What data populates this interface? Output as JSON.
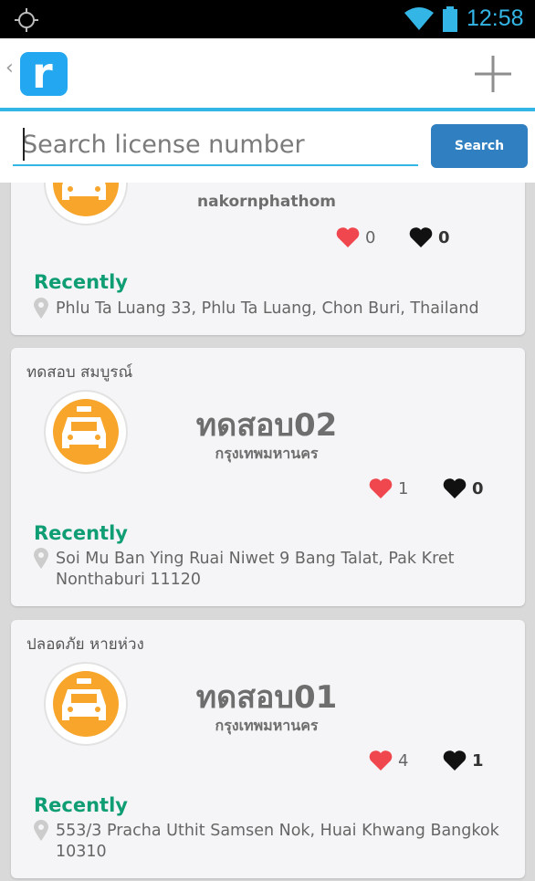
{
  "status_bar": {
    "time": "12:58"
  },
  "action_bar": {
    "back_glyph": "‹",
    "logo_letter": "r"
  },
  "search": {
    "placeholder": "Search license number",
    "button_label": "Search"
  },
  "cards": [
    {
      "owner": "",
      "plate": "",
      "province": "nakornphathom",
      "likes": "0",
      "dislikes": "0",
      "recent_label": "Recently",
      "address": "Phlu Ta Luang 33, Phlu Ta Luang, Chon Buri, Thailand"
    },
    {
      "owner": "ทดสอบ สมบูรณ์",
      "plate": "ทดสอบ02",
      "province": "กรุงเทพมหานคร",
      "likes": "1",
      "dislikes": "0",
      "recent_label": "Recently",
      "address": "Soi Mu Ban Ying Ruai Niwet 9 Bang Talat, Pak Kret Nonthaburi 11120"
    },
    {
      "owner": "ปลอดภัย หายห่วง",
      "plate": "ทดสอบ01",
      "province": "กรุงเทพมหานคร",
      "likes": "4",
      "dislikes": "1",
      "recent_label": "Recently",
      "address": "553/3 Pracha Uthit Samsen Nok, Huai Khwang Bangkok 10310"
    }
  ],
  "colors": {
    "accent": "#33b5e5",
    "button": "#2f7fc1",
    "recent": "#0f9d74",
    "taxi": "#f8a62b",
    "like": "#f0474f"
  }
}
